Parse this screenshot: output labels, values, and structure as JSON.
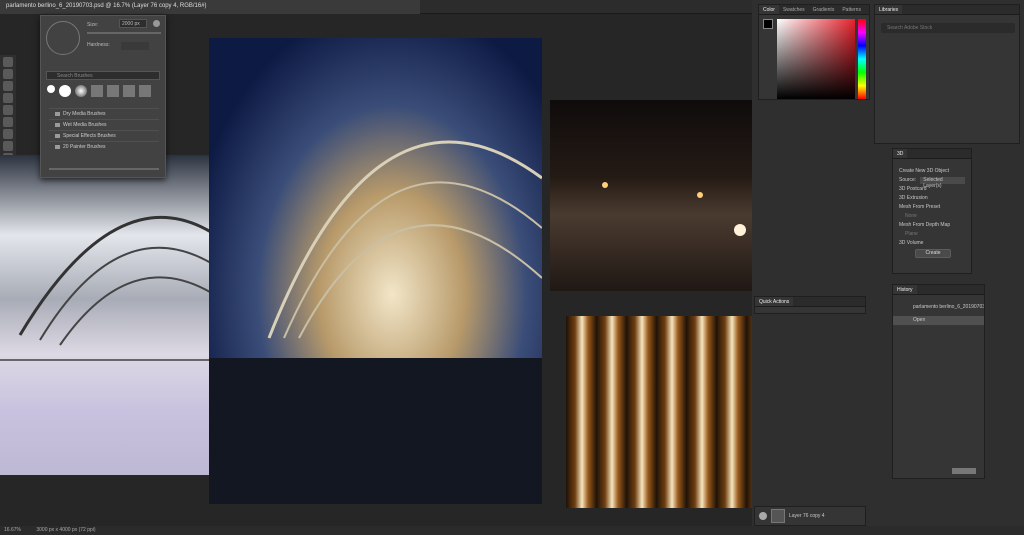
{
  "document_tab": {
    "title": "parlamento berlino_6_20190703.psd @ 16.7% (Layer 76 copy 4, RGB/16#)"
  },
  "status_bar": {
    "zoom": "16.67%",
    "doc_size": "3000 px x 4000 px (72 ppi)"
  },
  "brush_popup": {
    "size_label": "Size:",
    "size_value": "2000 px",
    "hardness_label": "Hardness:",
    "search_placeholder": "Search Brushes",
    "folders": [
      "Dry Media Brushes",
      "Wet Media Brushes",
      "Special Effects Brushes",
      "20 Painter Brushes"
    ]
  },
  "color_panel": {
    "tabs": [
      "Color",
      "Swatches",
      "Gradients",
      "Patterns"
    ]
  },
  "libraries_panel": {
    "tab": "Libraries",
    "search_placeholder": "Search Adobe Stock"
  },
  "panel_3d": {
    "tab": "3D",
    "title": "Create New 3D Object",
    "source_label": "Source:",
    "source_value": "Selected Layer(s)",
    "options": [
      "3D Postcard",
      "3D Extrusion",
      "Mesh From Preset",
      "None",
      "Mesh From Depth Map",
      "Plane",
      "3D Volume"
    ],
    "create_button": "Create"
  },
  "history_panel": {
    "tab": "History",
    "doc_name": "parlamento berlino_6_20190703...",
    "state": "Open"
  },
  "quick_actions": {
    "tab": "Quick Actions"
  },
  "layers_panel": {
    "layer_name": "Layer 76 copy 4"
  }
}
